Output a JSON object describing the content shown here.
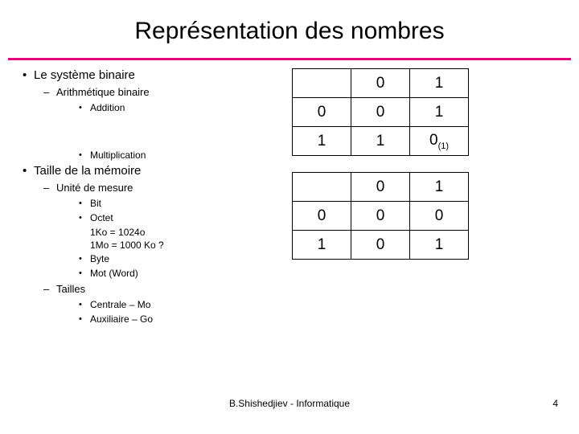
{
  "slide": {
    "title": "Représentation des nombres",
    "accent_color": "#e6007e",
    "footer": "B.Shishedjiev - Informatique",
    "page_number": "4"
  },
  "bullets": [
    {
      "level": 1,
      "text": "Le système binaire"
    },
    {
      "level": 2,
      "text": "Arithmétique binaire"
    },
    {
      "level": 3,
      "text": "Addition"
    },
    {
      "level": 3,
      "text": "Multiplication"
    },
    {
      "level": 1,
      "text": "Taille de la mémoire"
    },
    {
      "level": 2,
      "text": "Unité de mesure"
    },
    {
      "level": 3,
      "text": "Bit"
    },
    {
      "level": 3,
      "text": "Octet"
    },
    {
      "level": 4,
      "text": "1Ko = 1024o"
    },
    {
      "level": 4,
      "text": "1Mo = 1000 Ko ?"
    },
    {
      "level": 3,
      "text": "Byte"
    },
    {
      "level": 3,
      "text": "Mot (Word)"
    },
    {
      "level": 2,
      "text": "Tailles"
    },
    {
      "level": 3,
      "text": "Centrale – Mo"
    },
    {
      "level": 3,
      "text": "Auxiliaire – Go"
    }
  ],
  "tables": {
    "addition": {
      "name": "addition-table",
      "rows": [
        [
          "",
          "0",
          "1"
        ],
        [
          "0",
          "0",
          "1"
        ],
        [
          "1",
          "1",
          "0"
        ]
      ],
      "carry_note": "(1)",
      "carry_cell": {
        "row": 2,
        "col": 2
      }
    },
    "multiplication": {
      "name": "multiplication-table",
      "rows": [
        [
          "",
          "0",
          "1"
        ],
        [
          "0",
          "0",
          "0"
        ],
        [
          "1",
          "0",
          "1"
        ]
      ]
    }
  }
}
